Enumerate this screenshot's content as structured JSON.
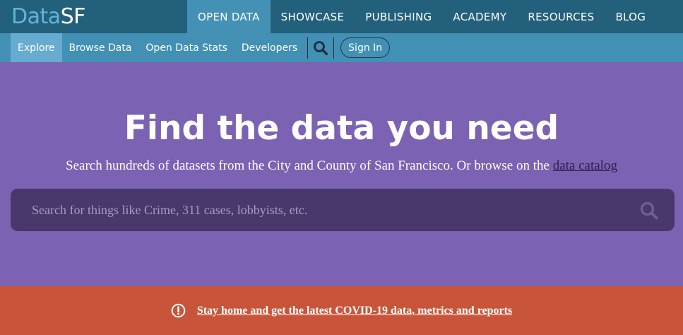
{
  "logo": {
    "part1": "Data",
    "part2": "SF"
  },
  "main_nav": [
    {
      "label": "OPEN DATA",
      "active": true
    },
    {
      "label": "SHOWCASE"
    },
    {
      "label": "PUBLISHING"
    },
    {
      "label": "ACADEMY"
    },
    {
      "label": "RESOURCES"
    },
    {
      "label": "BLOG"
    }
  ],
  "sub_nav": {
    "items": [
      {
        "label": "Explore",
        "active": true
      },
      {
        "label": "Browse Data"
      },
      {
        "label": "Open Data Stats"
      },
      {
        "label": "Developers"
      }
    ],
    "search_icon": "search-icon",
    "signin_label": "Sign In"
  },
  "hero": {
    "title": "Find the data you need",
    "subtitle_text": "Search hundreds of datasets from the City and County of San Francisco. Or browse on the ",
    "subtitle_link": "data catalog",
    "search_placeholder": "Search for things like Crime, 311 cases, lobbyists, etc.",
    "search_value": ""
  },
  "alert": {
    "icon": "alert-circle-icon",
    "link_text": "Stay home and get the latest COVID-19 data, metrics and reports"
  },
  "colors": {
    "topnav_bg": "#23607b",
    "subnav_bg": "#4290b3",
    "hero_bg": "#7c62b2",
    "search_bg": "#49386b",
    "alert_bg": "#c8553a"
  }
}
